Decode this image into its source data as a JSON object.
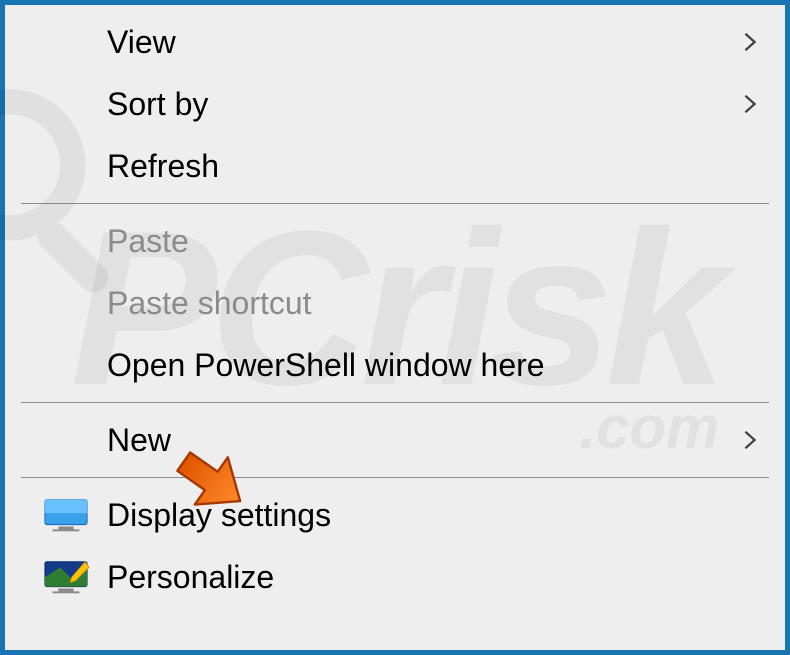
{
  "menu": {
    "items": [
      {
        "id": "view",
        "label": "View",
        "submenu": true,
        "disabled": false,
        "icon": null
      },
      {
        "id": "sort-by",
        "label": "Sort by",
        "submenu": true,
        "disabled": false,
        "icon": null
      },
      {
        "id": "refresh",
        "label": "Refresh",
        "submenu": false,
        "disabled": false,
        "icon": null
      },
      {
        "sep": true
      },
      {
        "id": "paste",
        "label": "Paste",
        "submenu": false,
        "disabled": true,
        "icon": null
      },
      {
        "id": "paste-shortcut",
        "label": "Paste shortcut",
        "submenu": false,
        "disabled": true,
        "icon": null
      },
      {
        "id": "open-powershell",
        "label": "Open PowerShell window here",
        "submenu": false,
        "disabled": false,
        "icon": null
      },
      {
        "sep": true
      },
      {
        "id": "new",
        "label": "New",
        "submenu": true,
        "disabled": false,
        "icon": null
      },
      {
        "sep": true
      },
      {
        "id": "display-settings",
        "label": "Display settings",
        "submenu": false,
        "disabled": false,
        "icon": "monitor"
      },
      {
        "id": "personalize",
        "label": "Personalize",
        "submenu": false,
        "disabled": false,
        "icon": "personalize"
      }
    ]
  },
  "watermark": {
    "main": "PCrisk",
    "sub": ".com"
  },
  "highlight_target": "display-settings"
}
